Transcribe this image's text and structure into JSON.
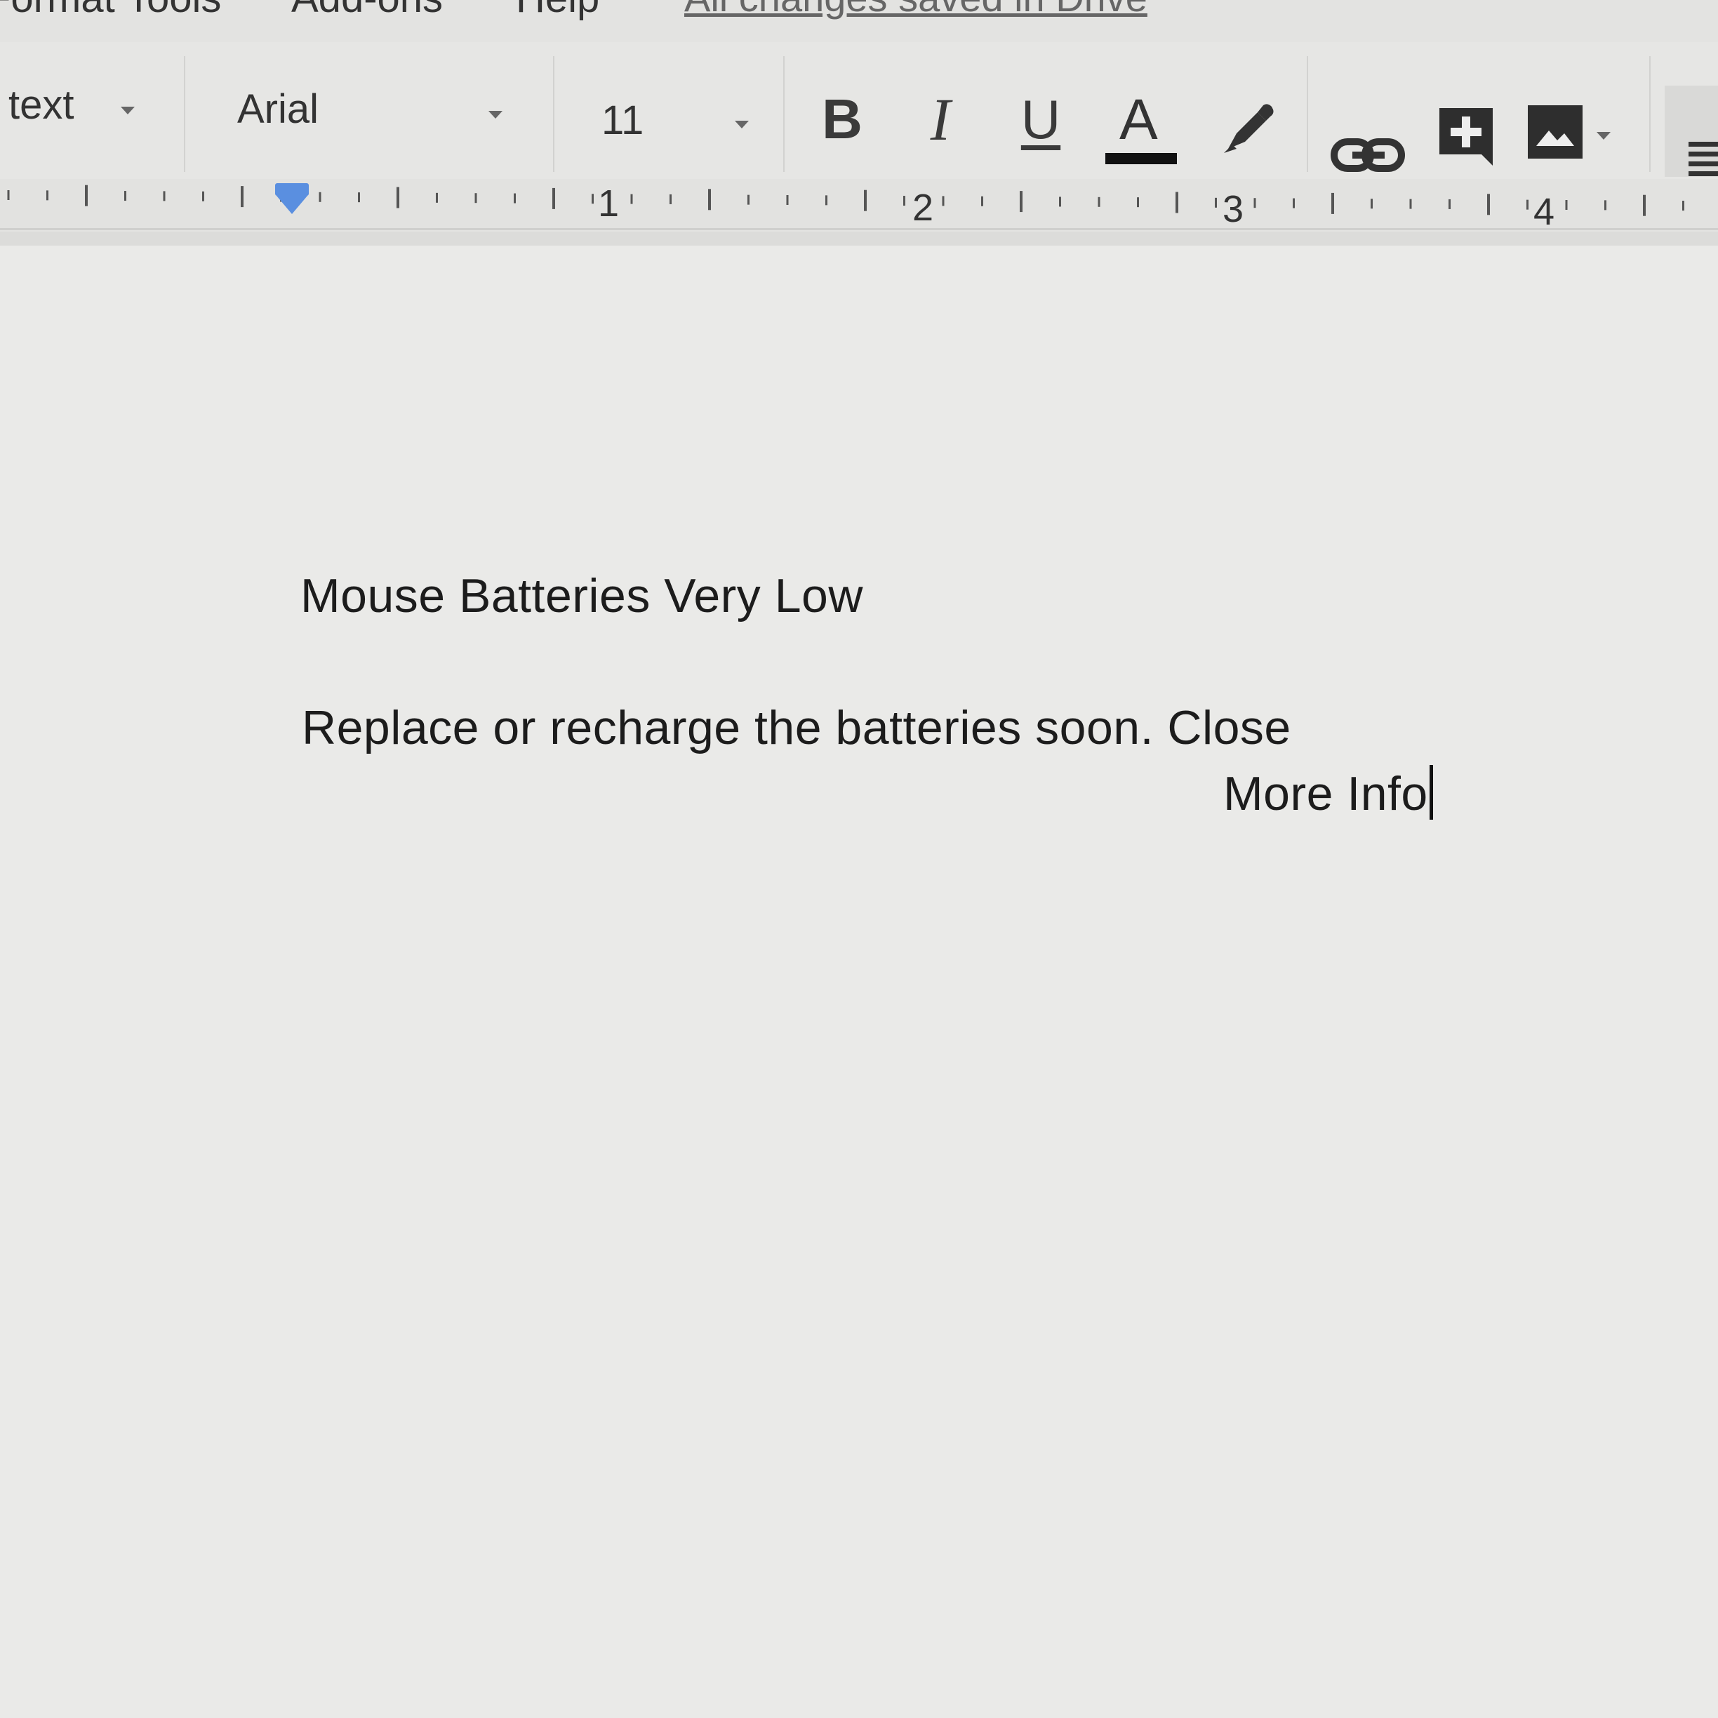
{
  "menu": {
    "items": [
      "Format",
      "Tools",
      "Add-ons",
      "Help"
    ],
    "save_status": "All changes saved in Drive"
  },
  "toolbar": {
    "style_label": "text",
    "font_label": "Arial",
    "size_label": "11",
    "bold_label": "B",
    "italic_label": "I",
    "underline_label": "U",
    "text_color_label": "A",
    "text_color": "#111111",
    "icons": [
      "highlighter-icon",
      "link-icon",
      "comment-add-icon",
      "image-icon",
      "more-icon"
    ]
  },
  "ruler": {
    "labels": [
      "1",
      "2",
      "3",
      "4"
    ],
    "indent_color": "#5a8fe0"
  },
  "document": {
    "line1": "Mouse Batteries Very Low",
    "line2": "Replace or recharge the batteries soon. Close",
    "line3": "More Info"
  }
}
